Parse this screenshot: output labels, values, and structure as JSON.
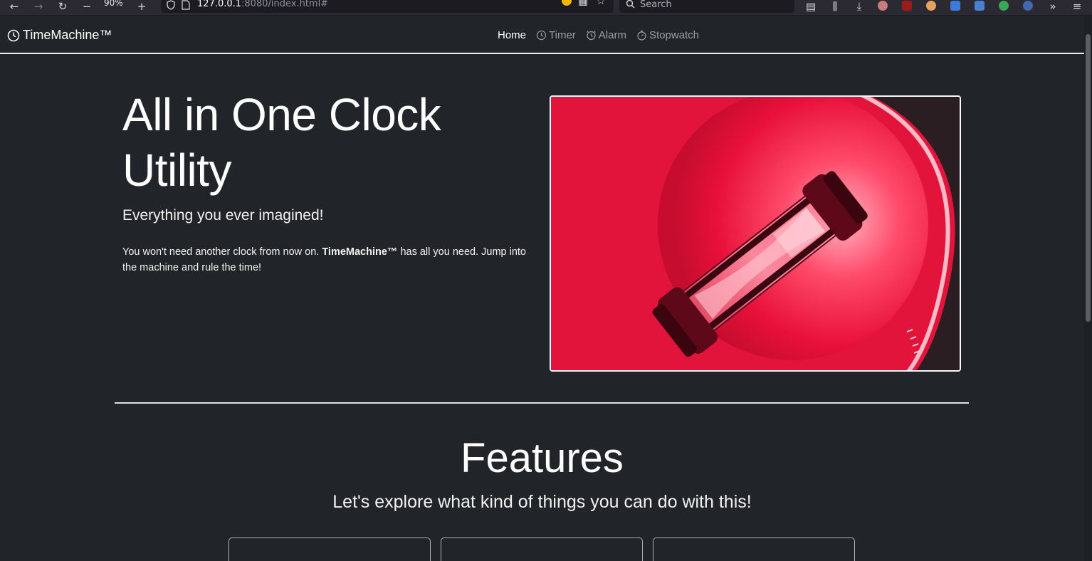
{
  "browser": {
    "zoom": "90%",
    "url_host": "127.0.0.1",
    "url_path": ":8080/index.html#",
    "search_placeholder": "Search"
  },
  "navbar": {
    "brand": "TimeMachine™",
    "items": [
      {
        "label": "Home",
        "icon": "none",
        "active": true
      },
      {
        "label": "Timer",
        "icon": "clock-icon",
        "active": false
      },
      {
        "label": "Alarm",
        "icon": "alarm-icon",
        "active": false
      },
      {
        "label": "Stopwatch",
        "icon": "stopwatch-icon",
        "active": false
      }
    ]
  },
  "hero": {
    "title": "All in One Clock Utility",
    "lead": "Everything you ever imagined!",
    "text_before": "You won't need another clock from now on. ",
    "text_bold": "TimeMachine™",
    "text_after": " has all you need. Jump into the machine and rule the time!",
    "image": "hourglass-image"
  },
  "features": {
    "title": "Features",
    "subtitle": "Let's explore what kind of things you can do with this!"
  },
  "colors": {
    "background": "#212529",
    "image_red": "#e0153a"
  }
}
